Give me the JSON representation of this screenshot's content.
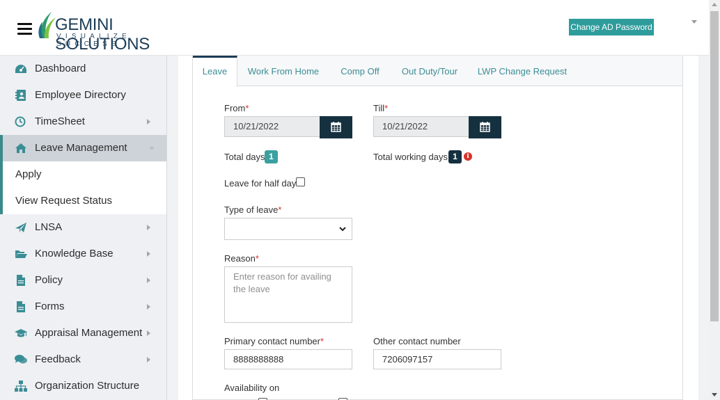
{
  "header": {
    "logo_name": "GEMINI SOLUTIONS",
    "logo_tagline": "VISUALIZE SUCCESS",
    "change_password_label": "Change AD Password"
  },
  "sidebar": {
    "items": [
      {
        "label": "Dashboard",
        "icon": "dashboard-icon"
      },
      {
        "label": "Employee Directory",
        "icon": "address-book-icon"
      },
      {
        "label": "TimeSheet",
        "icon": "clock-icon"
      },
      {
        "label": "Leave Management",
        "icon": "home-icon"
      },
      {
        "label": "LNSA",
        "icon": "paper-plane-icon"
      },
      {
        "label": "Knowledge Base",
        "icon": "folder-open-icon"
      },
      {
        "label": "Policy",
        "icon": "file-icon"
      },
      {
        "label": "Forms",
        "icon": "file-icon"
      },
      {
        "label": "Appraisal Management",
        "icon": "graduation-cap-icon"
      },
      {
        "label": "Feedback",
        "icon": "comments-icon"
      },
      {
        "label": "Organization Structure",
        "icon": "sitemap-icon"
      }
    ],
    "sub_items": [
      {
        "label": "Apply"
      },
      {
        "label": "View Request Status"
      }
    ]
  },
  "tabs": [
    {
      "label": "Leave"
    },
    {
      "label": "Work From Home"
    },
    {
      "label": "Comp Off"
    },
    {
      "label": "Out Duty/Tour"
    },
    {
      "label": "LWP Change Request"
    }
  ],
  "form": {
    "from_label": "From",
    "from_value": "10/21/2022",
    "till_label": "Till",
    "till_value": "10/21/2022",
    "required_mark": "*",
    "total_days_label": "Total days",
    "total_days_value": "1",
    "total_working_days_label": "Total working days",
    "total_working_days_value": "1",
    "half_day_label": "Leave for half day",
    "type_of_leave_label": "Type of leave",
    "type_of_leave_value": "",
    "reason_label": "Reason",
    "reason_placeholder": "Enter reason for availing the leave",
    "primary_contact_label": "Primary contact number",
    "primary_contact_value": "8888888888",
    "other_contact_label": "Other contact number",
    "other_contact_value": "7206097157",
    "availability_label": "Availability on"
  },
  "colors": {
    "accent_teal": "#2f9c9c",
    "dark_navy": "#15303f",
    "required_red": "#d9312b"
  }
}
